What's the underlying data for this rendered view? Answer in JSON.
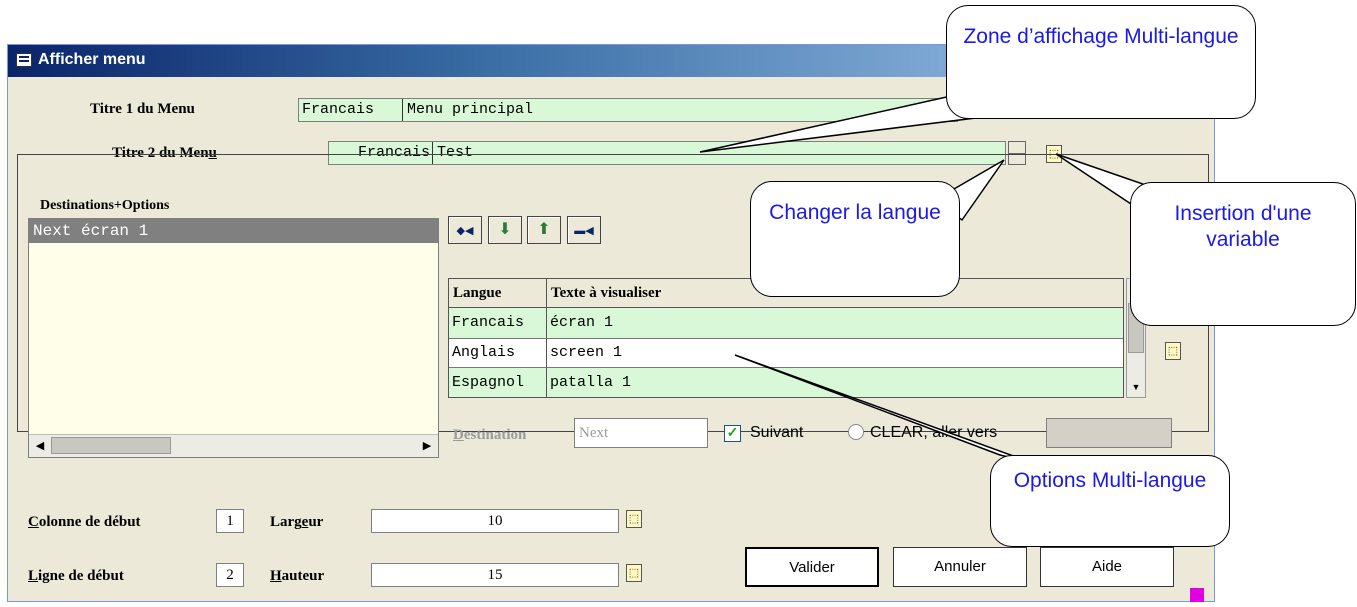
{
  "window": {
    "title": "Afficher menu"
  },
  "menu": {
    "titre1_label": "Titre 1 du Menu",
    "titre1_lang": "Francais",
    "titre1_value": "Menu principal",
    "titre2_label_pre": "Titre 2 du Men",
    "titre2_label_u": "u",
    "titre2_lang": "Francais",
    "titre2_value": "Test"
  },
  "destinations": {
    "group_label": "Destinations+Options",
    "items": [
      "Next écran 1"
    ]
  },
  "nav_buttons": [
    {
      "icon": "move-first-icon",
      "glyph": "◆◀"
    },
    {
      "icon": "arrow-down-icon",
      "glyph": "⬇"
    },
    {
      "icon": "arrow-up-icon",
      "glyph": "⬆"
    },
    {
      "icon": "move-last-icon",
      "glyph": "▬◀"
    }
  ],
  "grid": {
    "headers": [
      "Langue",
      "Texte à visualiser"
    ],
    "rows": [
      {
        "lang": "Francais",
        "text": "écran 1"
      },
      {
        "lang": "Anglais",
        "text": "screen 1"
      },
      {
        "lang": "Espagnol",
        "text": "patalla 1"
      }
    ]
  },
  "destination_row": {
    "label_u": "D",
    "label_rest": "estination",
    "value": "Next",
    "suivant_label": "Suivant",
    "suivant_checked": true,
    "clear_label": "CLEAR, aller vers"
  },
  "bottom": {
    "colonne_label_u": "C",
    "colonne_label_rest": "olonne de début",
    "colonne_value": "1",
    "largeur_label_pre": "Larg",
    "largeur_label_u": "e",
    "largeur_label_post": "ur",
    "largeur_value": "10",
    "ligne_label_u": "L",
    "ligne_label_rest": "igne de début",
    "ligne_value": "2",
    "hauteur_label_u": "H",
    "hauteur_label_rest": "auteur",
    "hauteur_value": "15"
  },
  "buttons": {
    "valider": "Valider",
    "annuler": "Annuler",
    "aide": "Aide"
  },
  "callouts": {
    "zone": "Zone d’affichage Multi-langue",
    "changer": "Changer la langue",
    "insertion": "Insertion d'une variable",
    "options": "Options Multi-langue"
  },
  "colors": {
    "field_green": "#d8f8d8",
    "callout_text": "#1a1ae6",
    "titlebar": "#0a246a"
  }
}
